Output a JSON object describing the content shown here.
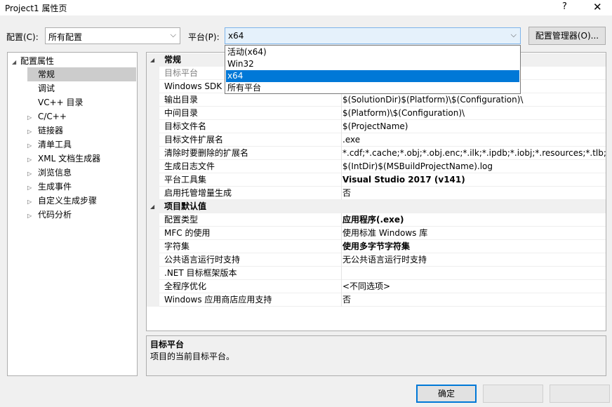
{
  "window": {
    "title": "Project1 属性页",
    "help": "?",
    "close": "✕"
  },
  "config": {
    "label": "配置(C):",
    "value": "所有配置"
  },
  "platform": {
    "label": "平台(P):",
    "value": "x64",
    "options": [
      "活动(x64)",
      "Win32",
      "x64",
      "所有平台"
    ],
    "selected_index": 2
  },
  "config_manager_label": "配置管理器(O)...",
  "tree": {
    "items": [
      {
        "label": "配置属性",
        "toggle": "◢"
      },
      {
        "label": "常规",
        "toggle": ""
      },
      {
        "label": "调试",
        "toggle": ""
      },
      {
        "label": "VC++ 目录",
        "toggle": ""
      },
      {
        "label": "C/C++",
        "toggle": "▷"
      },
      {
        "label": "链接器",
        "toggle": "▷"
      },
      {
        "label": "清单工具",
        "toggle": "▷"
      },
      {
        "label": "XML 文档生成器",
        "toggle": "▷"
      },
      {
        "label": "浏览信息",
        "toggle": "▷"
      },
      {
        "label": "生成事件",
        "toggle": "▷"
      },
      {
        "label": "自定义生成步骤",
        "toggle": "▷"
      },
      {
        "label": "代码分析",
        "toggle": "▷"
      }
    ],
    "selected": "常规"
  },
  "grid": {
    "cat1": {
      "label": "常规",
      "toggle": "◢"
    },
    "cat2": {
      "label": "项目默认值",
      "toggle": "◢"
    },
    "rows": [
      {
        "name": "目标平台",
        "value": ""
      },
      {
        "name": "Windows SDK 版本",
        "value": ""
      },
      {
        "name": "输出目录",
        "value": "$(SolutionDir)$(Platform)\\$(Configuration)\\"
      },
      {
        "name": "中间目录",
        "value": "$(Platform)\\$(Configuration)\\"
      },
      {
        "name": "目标文件名",
        "value": "$(ProjectName)"
      },
      {
        "name": "目标文件扩展名",
        "value": ".exe"
      },
      {
        "name": "清除时要删除的扩展名",
        "value": "*.cdf;*.cache;*.obj;*.obj.enc;*.ilk;*.ipdb;*.iobj;*.resources;*.tlb;*.tli;*.t"
      },
      {
        "name": "生成日志文件",
        "value": "$(IntDir)$(MSBuildProjectName).log"
      },
      {
        "name": "平台工具集",
        "value": "Visual Studio 2017 (v141)"
      },
      {
        "name": "启用托管增量生成",
        "value": "否"
      },
      {
        "name": "配置类型",
        "value": "应用程序(.exe)"
      },
      {
        "name": "MFC 的使用",
        "value": "使用标准 Windows 库"
      },
      {
        "name": "字符集",
        "value": "使用多字节字符集"
      },
      {
        "name": "公共语言运行时支持",
        "value": "无公共语言运行时支持"
      },
      {
        "name": ".NET 目标框架版本",
        "value": ""
      },
      {
        "name": "全程序优化",
        "value": "<不同选项>"
      },
      {
        "name": "Windows 应用商店应用支持",
        "value": "否"
      }
    ]
  },
  "description": {
    "title": "目标平台",
    "text": "项目的当前目标平台。"
  },
  "buttons": {
    "ok": "确定",
    "cancel": "",
    "apply": ""
  },
  "colors": {
    "accent": "#0078d7",
    "selection": "#cccccc"
  }
}
